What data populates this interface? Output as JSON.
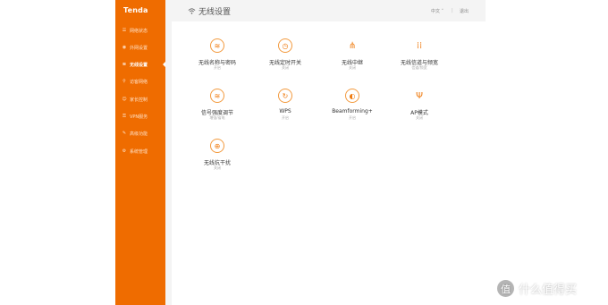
{
  "brand": {
    "logo": "Tenda",
    "accent": "#ef6c00"
  },
  "sidebar": {
    "items": [
      {
        "label": "网络状态",
        "icon": "network-status-icon",
        "glyph": "☰",
        "active": false
      },
      {
        "label": "外网设置",
        "icon": "globe-icon",
        "glyph": "◉",
        "active": false
      },
      {
        "label": "无线设置",
        "icon": "wifi-icon",
        "glyph": "≋",
        "active": true
      },
      {
        "label": "访客网络",
        "icon": "guest-icon",
        "glyph": "⚲",
        "active": false
      },
      {
        "label": "家长控制",
        "icon": "parental-icon",
        "glyph": "☺",
        "active": false
      },
      {
        "label": "VPN服务",
        "icon": "vpn-icon",
        "glyph": "⚿",
        "active": false
      },
      {
        "label": "高级功能",
        "icon": "tools-icon",
        "glyph": "✎",
        "active": false
      },
      {
        "label": "系统管理",
        "icon": "gear-icon",
        "glyph": "⚙",
        "active": false
      }
    ]
  },
  "header": {
    "title": "无线设置",
    "lang": "中文",
    "lang_arrow": "˅",
    "separator": "|",
    "logout": "退出"
  },
  "tiles": [
    {
      "label": "无线名称与密码",
      "sub": "开启",
      "icon": "wifi-password-icon",
      "glyph": "≋",
      "style": "circ"
    },
    {
      "label": "无线定时开关",
      "sub": "关闭",
      "icon": "wifi-timer-icon",
      "glyph": "◷",
      "style": "circ"
    },
    {
      "label": "无线中继",
      "sub": "关闭",
      "icon": "repeater-icon",
      "glyph": "⋔",
      "style": "bare"
    },
    {
      "label": "无线信道与频宽",
      "sub": "信道/频宽",
      "icon": "channel-icon",
      "glyph": "⁞⁞",
      "style": "bare"
    },
    {
      "label": "信号强度调节",
      "sub": "增强/省电",
      "icon": "signal-strength-icon",
      "glyph": "≋",
      "style": "circ"
    },
    {
      "label": "WPS",
      "sub": "开启",
      "icon": "wps-icon",
      "glyph": "↻",
      "style": "circ"
    },
    {
      "label": "Beamforming+",
      "sub": "开启",
      "icon": "beamforming-icon",
      "glyph": "◐",
      "style": "circ"
    },
    {
      "label": "AP模式",
      "sub": "关闭",
      "icon": "ap-mode-icon",
      "glyph": "Ψ",
      "style": "bare"
    },
    {
      "label": "无线抗干扰",
      "sub": "关闭",
      "icon": "anti-interference-icon",
      "glyph": "⊕",
      "style": "circ"
    }
  ],
  "watermark": {
    "text": "什么值得买",
    "badge": "值"
  }
}
